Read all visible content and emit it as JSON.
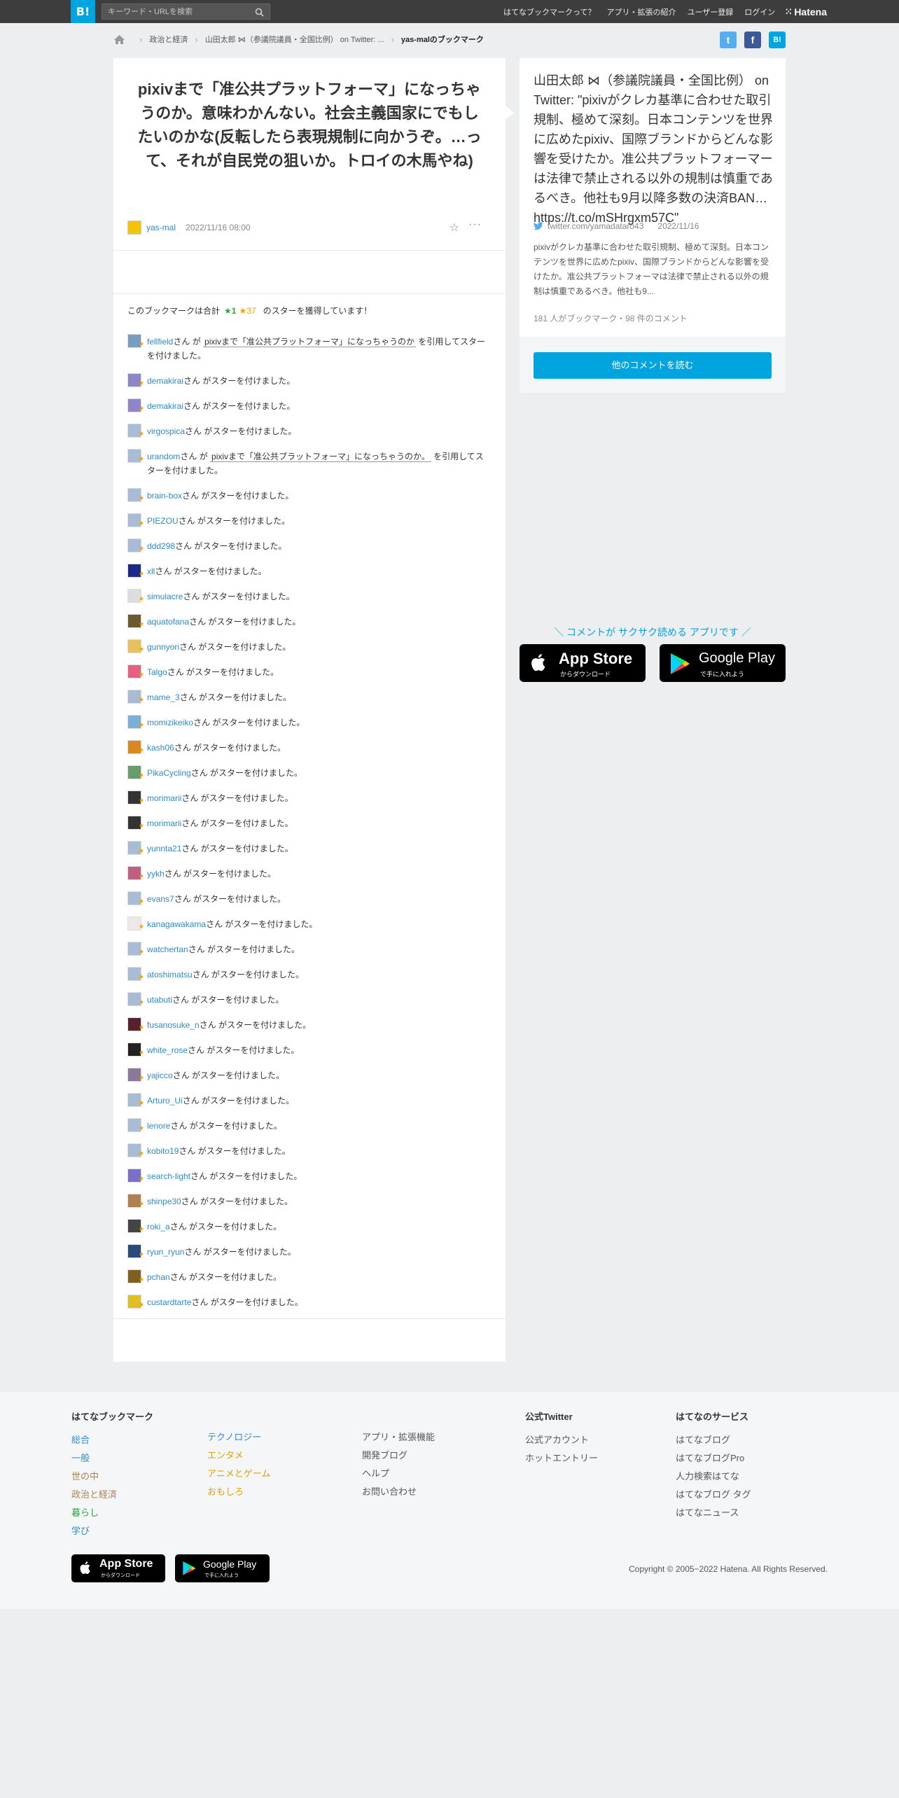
{
  "header": {
    "logo": "B!",
    "search_placeholder": "キーワード・URLを検索",
    "nav": [
      "はてなブックマークって？",
      "アプリ・拡張の紹介",
      "ユーザー登録",
      "ログイン"
    ],
    "brand": "Hatena"
  },
  "breadcrumb": {
    "items": [
      "政治と経済",
      "山田太郎 ⋈（参議院議員・全国比例） on Twitter: ..."
    ],
    "current": "yas-malのブックマーク"
  },
  "share": {
    "twitter": "t",
    "facebook": "f",
    "hatena": "B!"
  },
  "bookmark": {
    "title": "pixivまで「准公共プラットフォーマ」になっちゃうのか。意味わかんない。社会主義国家にでもしたいのかな(反転したら表現規制に向かうぞ。…って、それが自民党の狙いか。トロイの木馬やね)",
    "user": "yas-mal",
    "date": "2022/11/16 08:00",
    "more": "···"
  },
  "stars_summary": {
    "prefix": "このブックマークは合計",
    "green": "★1",
    "yellow": "★37",
    "suffix": "のスターを獲得しています！"
  },
  "entries": [
    {
      "name": "fellfield",
      "text": "さん が ",
      "quote": "pixivまで「准公共プラットフォーマ」になっちゃうのか",
      "tail": " を引用してスターを付けました。",
      "av": "#7a9cbf"
    },
    {
      "name": "demakirai",
      "text": "さん がスターを付けました。",
      "av": "#8e86c8"
    },
    {
      "name": "demakirai",
      "text": "さん がスターを付けました。",
      "av": "#8e86c8"
    },
    {
      "name": "virgospica",
      "text": "さん がスターを付けました。",
      "av": "#a9bcd6"
    },
    {
      "name": "urandom",
      "text": "さん が ",
      "quote": "pixivまで「准公共プラットフォーマ」になっちゃうのか。",
      "tail": " を引用してスターを付けました。",
      "av": "#a9bcd6"
    },
    {
      "name": "brain-box",
      "text": "さん がスターを付けました。",
      "av": "#a9bcd6"
    },
    {
      "name": "PIEZOU",
      "text": "さん がスターを付けました。",
      "av": "#a9bcd6"
    },
    {
      "name": "ddd298",
      "text": "さん がスターを付けました。",
      "av": "#a9bcd6"
    },
    {
      "name": "xll",
      "text": "さん がスターを付けました。",
      "av": "#1b2a8a"
    },
    {
      "name": "simulacre",
      "text": "さん がスターを付けました。",
      "av": "#dddddd"
    },
    {
      "name": "aquatofana",
      "text": "さん がスターを付けました。",
      "av": "#6b5a2e"
    },
    {
      "name": "gunnyori",
      "text": "さん がスターを付けました。",
      "av": "#e8c060"
    },
    {
      "name": "Talgo",
      "text": "さん がスターを付けました。",
      "av": "#e86080"
    },
    {
      "name": "mame_3",
      "text": "さん がスターを付けました。",
      "av": "#a9bcd6"
    },
    {
      "name": "momizikeiko",
      "text": "さん がスターを付けました。",
      "av": "#7ab0d8"
    },
    {
      "name": "kash06",
      "text": "さん がスターを付けました。",
      "av": "#d88a20"
    },
    {
      "name": "PikaCycling",
      "text": "さん がスターを付けました。",
      "av": "#6a9a70"
    },
    {
      "name": "morimarii",
      "text": "さん がスターを付けました。",
      "av": "#333333"
    },
    {
      "name": "morimarii",
      "text": "さん がスターを付けました。",
      "av": "#333333"
    },
    {
      "name": "yunnta21",
      "text": "さん がスターを付けました。",
      "av": "#a9bcd6"
    },
    {
      "name": "yykh",
      "text": "さん がスターを付けました。",
      "av": "#c06080"
    },
    {
      "name": "evans7",
      "text": "さん がスターを付けました。",
      "av": "#a9bcd6"
    },
    {
      "name": "kanagawakama",
      "text": "さん がスターを付けました。",
      "av": "#f0e8e8"
    },
    {
      "name": "watchertan",
      "text": "さん がスターを付けました。",
      "av": "#a9bcd6"
    },
    {
      "name": "atoshimatsu",
      "text": "さん がスターを付けました。",
      "av": "#a9bcd6"
    },
    {
      "name": "utabuti",
      "text": "さん がスターを付けました。",
      "av": "#a9bcd6"
    },
    {
      "name": "fusanosuke_n",
      "text": "さん がスターを付けました。",
      "av": "#5a2030"
    },
    {
      "name": "white_rose",
      "text": "さん がスターを付けました。",
      "av": "#222222"
    },
    {
      "name": "yajicco",
      "text": "さん がスターを付けました。",
      "av": "#8a7a9a"
    },
    {
      "name": "Arturo_Ui",
      "text": "さん がスターを付けました。",
      "av": "#a9bcd6"
    },
    {
      "name": "lenore",
      "text": "さん がスターを付けました。",
      "av": "#a9bcd6"
    },
    {
      "name": "kobito19",
      "text": "さん がスターを付けました。",
      "av": "#a9bcd6"
    },
    {
      "name": "search-light",
      "text": "さん がスターを付けました。",
      "av": "#7a70c8"
    },
    {
      "name": "shinpe30",
      "text": "さん がスターを付けました。",
      "av": "#b08050"
    },
    {
      "name": "roki_a",
      "text": "さん がスターを付けました。",
      "av": "#444444"
    },
    {
      "name": "ryun_ryun",
      "text": "さん がスターを付けました。",
      "av": "#2a4a7a"
    },
    {
      "name": "pchan",
      "text": "さん がスターを付けました。",
      "av": "#806020"
    },
    {
      "name": "custardtarte",
      "text": "さん がスターを付けました。",
      "av": "#e0c020"
    }
  ],
  "sidebar": {
    "title": "山田太郎 ⋈（参議院議員・全国比例） on Twitter: \"pixivがクレカ基準に合わせた取引規制、極めて深刻。日本コンテンツを世界に広めたpixiv、国際ブランドからどんな影響を受けたか。准公共プラットフォーマーは法律で禁止される以外の規制は慎重であるべき。他社も9月以降多数の決済BAN… https://t.co/mSHrgxm57C\"",
    "source": "twitter.com/yamadataro43",
    "date": "2022/11/16",
    "description": "pixivがクレカ基準に合わせた取引規制、極めて深刻。日本コンテンツを世界に広めたpixiv、国際ブランドからどんな影響を受けたか。准公共プラットフォーマは法律で禁止される以外の規制は慎重であるべき。他社も9...",
    "count": "181 人がブックマーク・98 件のコメント",
    "button": "他のコメントを読む"
  },
  "promo": {
    "text": "＼ コメントが サクサク読める アプリです ／",
    "appstore_big": "App Store",
    "appstore_small": "からダウンロード",
    "googleplay_big": "Google Play",
    "googleplay_small": "で手に入れよう"
  },
  "footer": {
    "col1_title": "はてなブックマーク",
    "col1a": [
      {
        "label": "総合",
        "color": "#2c8bc7"
      },
      {
        "label": "一般",
        "color": "#2c8bc7"
      },
      {
        "label": "世の中",
        "color": "#a8824e"
      },
      {
        "label": "政治と経済",
        "color": "#a8824e"
      },
      {
        "label": "暮らし",
        "color": "#27a640"
      },
      {
        "label": "学び",
        "color": "#2c8bc7"
      }
    ],
    "col1b": [
      {
        "label": "テクノロジー",
        "color": "#2c8bc7"
      },
      {
        "label": "エンタメ",
        "color": "#e0a000"
      },
      {
        "label": "アニメとゲーム",
        "color": "#e0a000"
      },
      {
        "label": "おもしろ",
        "color": "#e0a000"
      }
    ],
    "col2": [
      "アプリ・拡張機能",
      "開発ブログ",
      "ヘルプ",
      "お問い合わせ"
    ],
    "col3_title": "公式Twitter",
    "col3": [
      "公式アカウント",
      "ホットエントリー"
    ],
    "col4_title": "はてなのサービス",
    "col4": [
      "はてなブログ",
      "はてなブログPro",
      "人力検索はてな",
      "はてなブログ タグ",
      "はてなニュース"
    ],
    "copyright": "Copyright © 2005−2022 Hatena. All Rights Reserved."
  },
  "colors": {
    "accent": "#00a4de",
    "link": "#2c8bc7",
    "star_yellow": "#f0a000",
    "star_green": "#27a640"
  }
}
